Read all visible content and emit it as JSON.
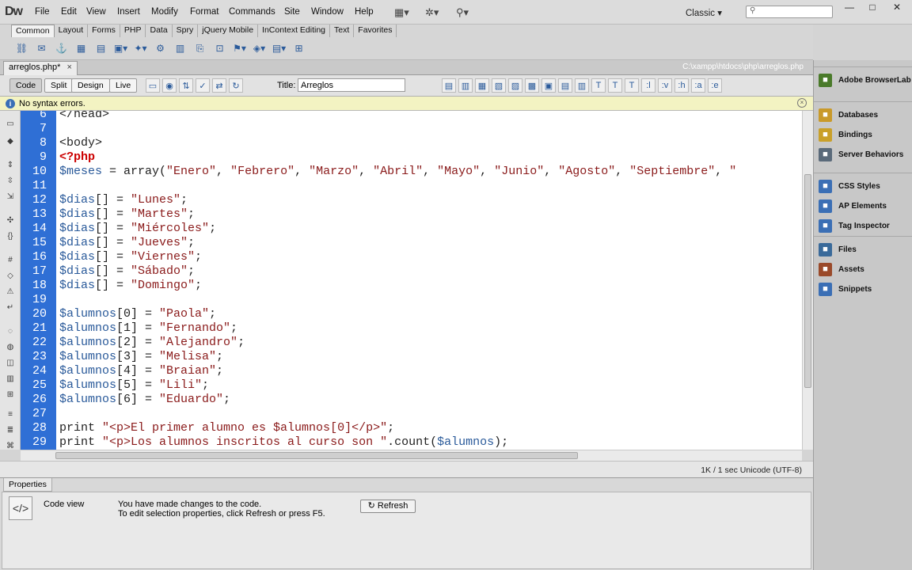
{
  "app": {
    "logo": "Dw"
  },
  "menu": [
    "File",
    "Edit",
    "View",
    "Insert",
    "Modify",
    "Format",
    "Commands",
    "Site",
    "Window",
    "Help"
  ],
  "workspace": {
    "label": "Classic",
    "chevron": "▾"
  },
  "window_controls": {
    "minimize": "—",
    "restore": "□",
    "close": "✕"
  },
  "insert_tabs": [
    "Common",
    "Layout",
    "Forms",
    "PHP",
    "Data",
    "Spry",
    "jQuery Mobile",
    "InContext Editing",
    "Text",
    "Favorites"
  ],
  "document": {
    "tab_name": "arreglos.php*",
    "tab_close": "×",
    "path": "C:\\xampp\\htdocs\\php\\arreglos.php",
    "views": [
      "Code",
      "Split",
      "Design",
      "Live"
    ],
    "title_label": "Title:",
    "title_value": "Arreglos",
    "code_nav": [
      ":l",
      ":v",
      ":h",
      ":a",
      ":e"
    ]
  },
  "info": {
    "icon": "i",
    "text": "No syntax errors.",
    "close": "×"
  },
  "code_lines": [
    {
      "n": "6",
      "parts": [
        [
          "tag",
          "</head>"
        ]
      ]
    },
    {
      "n": "7",
      "parts": []
    },
    {
      "n": "8",
      "parts": [
        [
          "tag",
          "<body>"
        ]
      ]
    },
    {
      "n": "9",
      "parts": [
        [
          "php",
          "<?php"
        ]
      ]
    },
    {
      "n": "10",
      "parts": [
        [
          "var",
          "$meses"
        ],
        [
          "plain",
          " = array("
        ],
        [
          "str",
          "\"Enero\""
        ],
        [
          "plain",
          ", "
        ],
        [
          "str",
          "\"Febrero\""
        ],
        [
          "plain",
          ", "
        ],
        [
          "str",
          "\"Marzo\""
        ],
        [
          "plain",
          ", "
        ],
        [
          "str",
          "\"Abril\""
        ],
        [
          "plain",
          ", "
        ],
        [
          "str",
          "\"Mayo\""
        ],
        [
          "plain",
          ", "
        ],
        [
          "str",
          "\"Junio\""
        ],
        [
          "plain",
          ", "
        ],
        [
          "str",
          "\"Agosto\""
        ],
        [
          "plain",
          ", "
        ],
        [
          "str",
          "\"Septiembre\""
        ],
        [
          "plain",
          ", "
        ],
        [
          "str",
          "\""
        ]
      ]
    },
    {
      "n": "11",
      "parts": []
    },
    {
      "n": "12",
      "parts": [
        [
          "var",
          "$dias"
        ],
        [
          "plain",
          "[] = "
        ],
        [
          "str",
          "\"Lunes\""
        ],
        [
          "plain",
          ";"
        ]
      ]
    },
    {
      "n": "13",
      "parts": [
        [
          "var",
          "$dias"
        ],
        [
          "plain",
          "[] = "
        ],
        [
          "str",
          "\"Martes\""
        ],
        [
          "plain",
          ";"
        ]
      ]
    },
    {
      "n": "14",
      "parts": [
        [
          "var",
          "$dias"
        ],
        [
          "plain",
          "[] = "
        ],
        [
          "str",
          "\"Miércoles\""
        ],
        [
          "plain",
          ";"
        ]
      ]
    },
    {
      "n": "15",
      "parts": [
        [
          "var",
          "$dias"
        ],
        [
          "plain",
          "[] = "
        ],
        [
          "str",
          "\"Jueves\""
        ],
        [
          "plain",
          ";"
        ]
      ]
    },
    {
      "n": "16",
      "parts": [
        [
          "var",
          "$dias"
        ],
        [
          "plain",
          "[] = "
        ],
        [
          "str",
          "\"Viernes\""
        ],
        [
          "plain",
          ";"
        ]
      ]
    },
    {
      "n": "17",
      "parts": [
        [
          "var",
          "$dias"
        ],
        [
          "plain",
          "[] = "
        ],
        [
          "str",
          "\"Sábado\""
        ],
        [
          "plain",
          ";"
        ]
      ]
    },
    {
      "n": "18",
      "parts": [
        [
          "var",
          "$dias"
        ],
        [
          "plain",
          "[] = "
        ],
        [
          "str",
          "\"Domingo\""
        ],
        [
          "plain",
          ";"
        ]
      ]
    },
    {
      "n": "19",
      "parts": []
    },
    {
      "n": "20",
      "parts": [
        [
          "var",
          "$alumnos"
        ],
        [
          "plain",
          "[0] = "
        ],
        [
          "str",
          "\"Paola\""
        ],
        [
          "plain",
          ";"
        ]
      ]
    },
    {
      "n": "21",
      "parts": [
        [
          "var",
          "$alumnos"
        ],
        [
          "plain",
          "[1] = "
        ],
        [
          "str",
          "\"Fernando\""
        ],
        [
          "plain",
          ";"
        ]
      ]
    },
    {
      "n": "22",
      "parts": [
        [
          "var",
          "$alumnos"
        ],
        [
          "plain",
          "[2] = "
        ],
        [
          "str",
          "\"Alejandro\""
        ],
        [
          "plain",
          ";"
        ]
      ]
    },
    {
      "n": "23",
      "parts": [
        [
          "var",
          "$alumnos"
        ],
        [
          "plain",
          "[3] = "
        ],
        [
          "str",
          "\"Melisa\""
        ],
        [
          "plain",
          ";"
        ]
      ]
    },
    {
      "n": "24",
      "parts": [
        [
          "var",
          "$alumnos"
        ],
        [
          "plain",
          "[4] = "
        ],
        [
          "str",
          "\"Braian\""
        ],
        [
          "plain",
          ";"
        ]
      ]
    },
    {
      "n": "25",
      "parts": [
        [
          "var",
          "$alumnos"
        ],
        [
          "plain",
          "[5] = "
        ],
        [
          "str",
          "\"Lili\""
        ],
        [
          "plain",
          ";"
        ]
      ]
    },
    {
      "n": "26",
      "parts": [
        [
          "var",
          "$alumnos"
        ],
        [
          "plain",
          "[6] = "
        ],
        [
          "str",
          "\"Eduardo\""
        ],
        [
          "plain",
          ";"
        ]
      ]
    },
    {
      "n": "27",
      "parts": []
    },
    {
      "n": "28",
      "parts": [
        [
          "plain",
          "print "
        ],
        [
          "str",
          "\"<p>El primer alumno es $alumnos[0]</p>\""
        ],
        [
          "plain",
          ";"
        ]
      ]
    },
    {
      "n": "29",
      "parts": [
        [
          "plain",
          "print "
        ],
        [
          "str",
          "\"<p>Los alumnos inscritos al curso son \""
        ],
        [
          "plain",
          "."
        ],
        [
          "plain",
          "count("
        ],
        [
          "var",
          "$alumnos"
        ],
        [
          "plain",
          ");"
        ]
      ]
    }
  ],
  "status": {
    "text": "1K / 1 sec  Unicode (UTF-8)"
  },
  "properties": {
    "tab": "Properties",
    "label": "Code view",
    "msg1": "You have made changes to the code.",
    "msg2": "To edit selection properties, click Refresh or press F5.",
    "refresh": "Refresh"
  },
  "panels": [
    {
      "group": 0,
      "items": [
        {
          "label": "Adobe BrowserLab",
          "icon": "browserlab-icon",
          "color": "#4a7a2a"
        }
      ]
    },
    {
      "group": 1,
      "items": [
        {
          "label": "Databases",
          "icon": "database-icon",
          "color": "#c99a2a"
        },
        {
          "label": "Bindings",
          "icon": "bindings-icon",
          "color": "#c9a02a"
        },
        {
          "label": "Server Behaviors",
          "icon": "server-behaviors-icon",
          "color": "#5a6a7a"
        }
      ]
    },
    {
      "group": 2,
      "items": [
        {
          "label": "CSS Styles",
          "icon": "css-styles-icon",
          "color": "#3b6fb5"
        },
        {
          "label": "AP Elements",
          "icon": "ap-elements-icon",
          "color": "#3b6fb5"
        },
        {
          "label": "Tag Inspector",
          "icon": "tag-inspector-icon",
          "color": "#3b6fb5"
        }
      ]
    },
    {
      "group": 3,
      "items": [
        {
          "label": "Files",
          "icon": "files-icon",
          "color": "#3a6a9a"
        },
        {
          "label": "Assets",
          "icon": "assets-icon",
          "color": "#9a4a2a"
        },
        {
          "label": "Snippets",
          "icon": "snippets-icon",
          "color": "#3b6fb5"
        }
      ]
    }
  ]
}
